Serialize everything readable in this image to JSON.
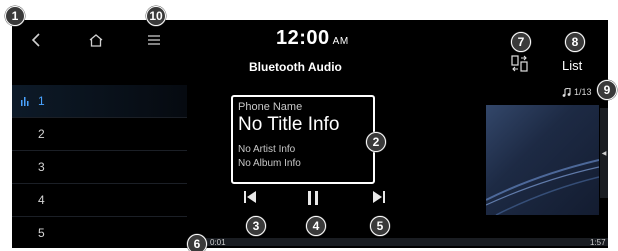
{
  "header": {
    "time": "12:00",
    "ampm": "AM",
    "title": "Bluetooth Audio",
    "list_label": "List"
  },
  "tracks": {
    "count_label": "1/13",
    "items": [
      "1",
      "2",
      "3",
      "4",
      "5"
    ],
    "active_index": 0
  },
  "now_playing": {
    "phone_name": "Phone Name",
    "title": "No Title Info",
    "artist": "No Artist Info",
    "album": "No Album Info"
  },
  "progress": {
    "elapsed": "0:01",
    "total": "1:57",
    "fraction": 0.01
  },
  "callouts": [
    "1",
    "2",
    "3",
    "4",
    "5",
    "6",
    "7",
    "8",
    "9",
    "10"
  ],
  "icons": {
    "back": "back-chevron-icon",
    "home": "home-icon",
    "menu": "menu-icon",
    "switch": "device-switch-icon",
    "note": "music-note-icon",
    "equalizer": "equalizer-icon",
    "prev": "skip-previous-icon",
    "pause": "pause-icon",
    "next": "skip-next-icon"
  },
  "colors": {
    "active_track": "#4aa3ff",
    "background": "#000000",
    "callout": "#3a3a3a"
  }
}
